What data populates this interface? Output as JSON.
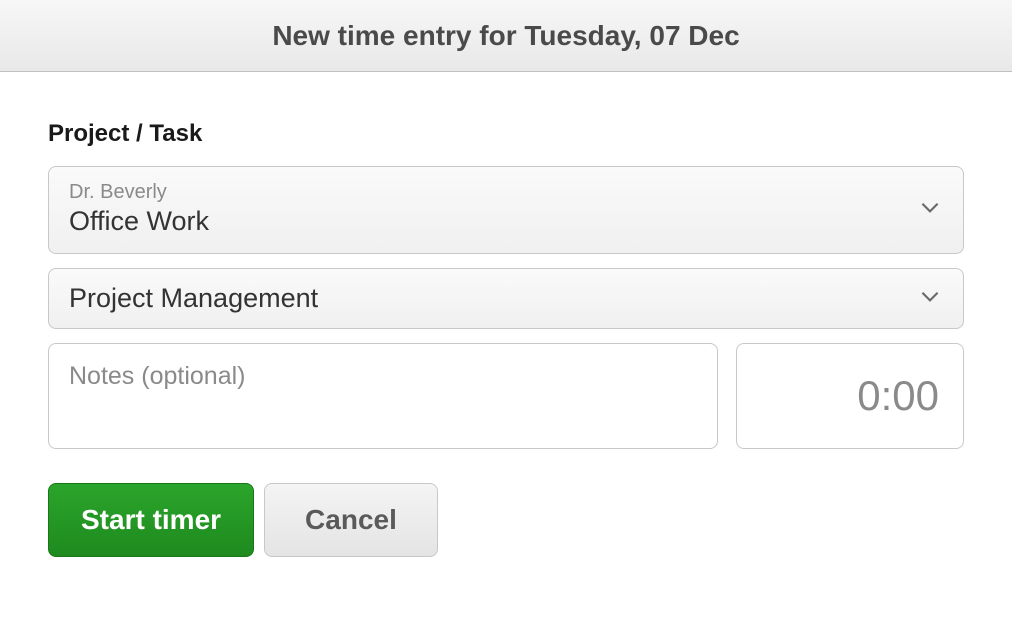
{
  "header": {
    "title": "New time entry for Tuesday, 07 Dec"
  },
  "form": {
    "section_label": "Project / Task",
    "project_select": {
      "client": "Dr. Beverly",
      "project": "Office Work"
    },
    "task_select": {
      "task": "Project Management"
    },
    "notes": {
      "placeholder": "Notes (optional)",
      "value": ""
    },
    "time": {
      "value": "0:00"
    },
    "buttons": {
      "start": "Start timer",
      "cancel": "Cancel"
    }
  }
}
